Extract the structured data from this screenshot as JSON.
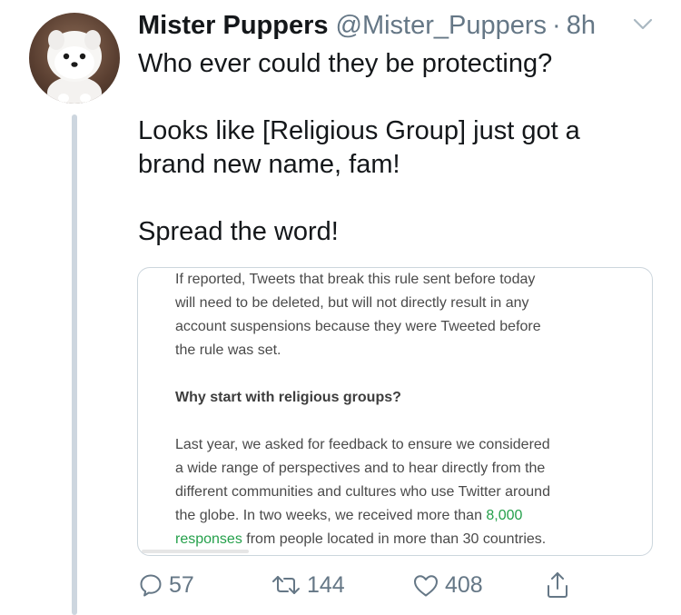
{
  "tweet": {
    "display_name": "Mister Puppers",
    "handle": "@Mister_Puppers",
    "separator": "·",
    "time": "8h",
    "text_lines": [
      "Who ever could they be protecting?",
      "Looks like [Religious Group] just got a",
      "brand new name, fam!",
      "Spread the word!"
    ],
    "avatar_icon": "pomeranian-puppy-avatar",
    "menu_icon": "chevron-down-icon"
  },
  "card": {
    "paragraph1_lines": [
      "If reported, Tweets that break this rule sent before today",
      "will need to be deleted, but will not directly result in any",
      "account suspensions because they were Tweeted before",
      "the rule was set."
    ],
    "heading": "Why start with religious groups?",
    "paragraph2_lines": [
      "Last year, we asked for feedback to ensure we considered",
      "a wide range of perspectives and to hear directly from the",
      "different communities and cultures who use Twitter around"
    ],
    "line4_text": "the globe. In two weeks, we received more than ",
    "line4_link": "8,000",
    "line5_link": "responses",
    "line5_text": " from people located in more than 30 countries.",
    "link_color": "#25a04b"
  },
  "actions": {
    "reply": {
      "icon": "reply-icon",
      "count": "57"
    },
    "retweet": {
      "icon": "retweet-icon",
      "count": "144"
    },
    "like": {
      "icon": "heart-icon",
      "count": "408"
    },
    "share": {
      "icon": "share-icon"
    }
  },
  "colors": {
    "text_primary": "#14171a",
    "text_secondary": "#657786",
    "thread_line": "#cdd6df",
    "card_border": "#ccd6dd"
  }
}
